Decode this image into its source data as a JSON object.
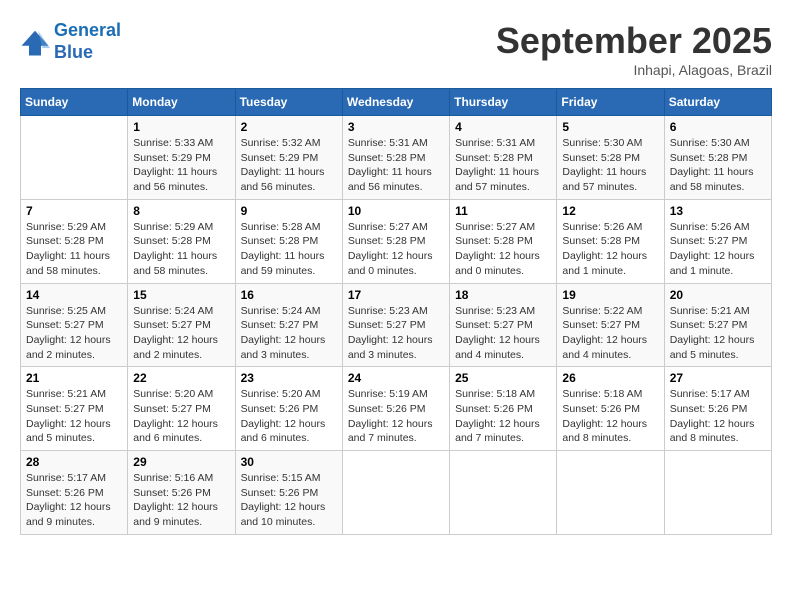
{
  "logo": {
    "line1": "General",
    "line2": "Blue"
  },
  "title": "September 2025",
  "subtitle": "Inhapi, Alagoas, Brazil",
  "weekdays": [
    "Sunday",
    "Monday",
    "Tuesday",
    "Wednesday",
    "Thursday",
    "Friday",
    "Saturday"
  ],
  "weeks": [
    [
      {
        "day": "",
        "info": ""
      },
      {
        "day": "1",
        "info": "Sunrise: 5:33 AM\nSunset: 5:29 PM\nDaylight: 11 hours\nand 56 minutes."
      },
      {
        "day": "2",
        "info": "Sunrise: 5:32 AM\nSunset: 5:29 PM\nDaylight: 11 hours\nand 56 minutes."
      },
      {
        "day": "3",
        "info": "Sunrise: 5:31 AM\nSunset: 5:28 PM\nDaylight: 11 hours\nand 56 minutes."
      },
      {
        "day": "4",
        "info": "Sunrise: 5:31 AM\nSunset: 5:28 PM\nDaylight: 11 hours\nand 57 minutes."
      },
      {
        "day": "5",
        "info": "Sunrise: 5:30 AM\nSunset: 5:28 PM\nDaylight: 11 hours\nand 57 minutes."
      },
      {
        "day": "6",
        "info": "Sunrise: 5:30 AM\nSunset: 5:28 PM\nDaylight: 11 hours\nand 58 minutes."
      }
    ],
    [
      {
        "day": "7",
        "info": "Sunrise: 5:29 AM\nSunset: 5:28 PM\nDaylight: 11 hours\nand 58 minutes."
      },
      {
        "day": "8",
        "info": "Sunrise: 5:29 AM\nSunset: 5:28 PM\nDaylight: 11 hours\nand 58 minutes."
      },
      {
        "day": "9",
        "info": "Sunrise: 5:28 AM\nSunset: 5:28 PM\nDaylight: 11 hours\nand 59 minutes."
      },
      {
        "day": "10",
        "info": "Sunrise: 5:27 AM\nSunset: 5:28 PM\nDaylight: 12 hours\nand 0 minutes."
      },
      {
        "day": "11",
        "info": "Sunrise: 5:27 AM\nSunset: 5:28 PM\nDaylight: 12 hours\nand 0 minutes."
      },
      {
        "day": "12",
        "info": "Sunrise: 5:26 AM\nSunset: 5:28 PM\nDaylight: 12 hours\nand 1 minute."
      },
      {
        "day": "13",
        "info": "Sunrise: 5:26 AM\nSunset: 5:27 PM\nDaylight: 12 hours\nand 1 minute."
      }
    ],
    [
      {
        "day": "14",
        "info": "Sunrise: 5:25 AM\nSunset: 5:27 PM\nDaylight: 12 hours\nand 2 minutes."
      },
      {
        "day": "15",
        "info": "Sunrise: 5:24 AM\nSunset: 5:27 PM\nDaylight: 12 hours\nand 2 minutes."
      },
      {
        "day": "16",
        "info": "Sunrise: 5:24 AM\nSunset: 5:27 PM\nDaylight: 12 hours\nand 3 minutes."
      },
      {
        "day": "17",
        "info": "Sunrise: 5:23 AM\nSunset: 5:27 PM\nDaylight: 12 hours\nand 3 minutes."
      },
      {
        "day": "18",
        "info": "Sunrise: 5:23 AM\nSunset: 5:27 PM\nDaylight: 12 hours\nand 4 minutes."
      },
      {
        "day": "19",
        "info": "Sunrise: 5:22 AM\nSunset: 5:27 PM\nDaylight: 12 hours\nand 4 minutes."
      },
      {
        "day": "20",
        "info": "Sunrise: 5:21 AM\nSunset: 5:27 PM\nDaylight: 12 hours\nand 5 minutes."
      }
    ],
    [
      {
        "day": "21",
        "info": "Sunrise: 5:21 AM\nSunset: 5:27 PM\nDaylight: 12 hours\nand 5 minutes."
      },
      {
        "day": "22",
        "info": "Sunrise: 5:20 AM\nSunset: 5:27 PM\nDaylight: 12 hours\nand 6 minutes."
      },
      {
        "day": "23",
        "info": "Sunrise: 5:20 AM\nSunset: 5:26 PM\nDaylight: 12 hours\nand 6 minutes."
      },
      {
        "day": "24",
        "info": "Sunrise: 5:19 AM\nSunset: 5:26 PM\nDaylight: 12 hours\nand 7 minutes."
      },
      {
        "day": "25",
        "info": "Sunrise: 5:18 AM\nSunset: 5:26 PM\nDaylight: 12 hours\nand 7 minutes."
      },
      {
        "day": "26",
        "info": "Sunrise: 5:18 AM\nSunset: 5:26 PM\nDaylight: 12 hours\nand 8 minutes."
      },
      {
        "day": "27",
        "info": "Sunrise: 5:17 AM\nSunset: 5:26 PM\nDaylight: 12 hours\nand 8 minutes."
      }
    ],
    [
      {
        "day": "28",
        "info": "Sunrise: 5:17 AM\nSunset: 5:26 PM\nDaylight: 12 hours\nand 9 minutes."
      },
      {
        "day": "29",
        "info": "Sunrise: 5:16 AM\nSunset: 5:26 PM\nDaylight: 12 hours\nand 9 minutes."
      },
      {
        "day": "30",
        "info": "Sunrise: 5:15 AM\nSunset: 5:26 PM\nDaylight: 12 hours\nand 10 minutes."
      },
      {
        "day": "",
        "info": ""
      },
      {
        "day": "",
        "info": ""
      },
      {
        "day": "",
        "info": ""
      },
      {
        "day": "",
        "info": ""
      }
    ]
  ]
}
